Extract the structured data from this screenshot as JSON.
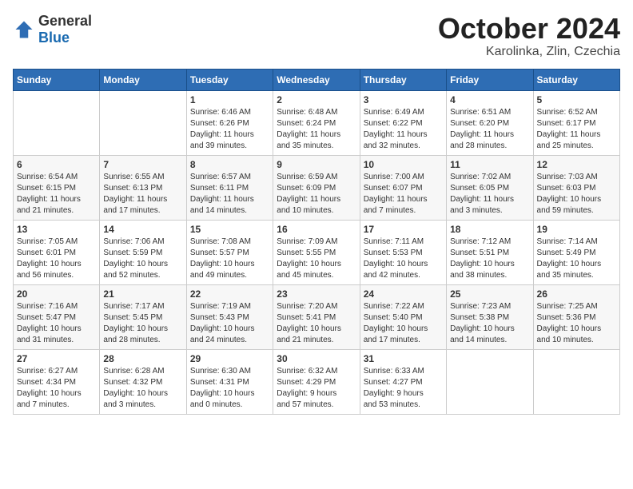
{
  "header": {
    "logo": {
      "general": "General",
      "blue": "Blue"
    },
    "month": "October 2024",
    "location": "Karolinka, Zlin, Czechia"
  },
  "weekdays": [
    "Sunday",
    "Monday",
    "Tuesday",
    "Wednesday",
    "Thursday",
    "Friday",
    "Saturday"
  ],
  "weeks": [
    [
      {
        "day": "",
        "info": ""
      },
      {
        "day": "",
        "info": ""
      },
      {
        "day": "1",
        "info": "Sunrise: 6:46 AM\nSunset: 6:26 PM\nDaylight: 11 hours\nand 39 minutes."
      },
      {
        "day": "2",
        "info": "Sunrise: 6:48 AM\nSunset: 6:24 PM\nDaylight: 11 hours\nand 35 minutes."
      },
      {
        "day": "3",
        "info": "Sunrise: 6:49 AM\nSunset: 6:22 PM\nDaylight: 11 hours\nand 32 minutes."
      },
      {
        "day": "4",
        "info": "Sunrise: 6:51 AM\nSunset: 6:20 PM\nDaylight: 11 hours\nand 28 minutes."
      },
      {
        "day": "5",
        "info": "Sunrise: 6:52 AM\nSunset: 6:17 PM\nDaylight: 11 hours\nand 25 minutes."
      }
    ],
    [
      {
        "day": "6",
        "info": "Sunrise: 6:54 AM\nSunset: 6:15 PM\nDaylight: 11 hours\nand 21 minutes."
      },
      {
        "day": "7",
        "info": "Sunrise: 6:55 AM\nSunset: 6:13 PM\nDaylight: 11 hours\nand 17 minutes."
      },
      {
        "day": "8",
        "info": "Sunrise: 6:57 AM\nSunset: 6:11 PM\nDaylight: 11 hours\nand 14 minutes."
      },
      {
        "day": "9",
        "info": "Sunrise: 6:59 AM\nSunset: 6:09 PM\nDaylight: 11 hours\nand 10 minutes."
      },
      {
        "day": "10",
        "info": "Sunrise: 7:00 AM\nSunset: 6:07 PM\nDaylight: 11 hours\nand 7 minutes."
      },
      {
        "day": "11",
        "info": "Sunrise: 7:02 AM\nSunset: 6:05 PM\nDaylight: 11 hours\nand 3 minutes."
      },
      {
        "day": "12",
        "info": "Sunrise: 7:03 AM\nSunset: 6:03 PM\nDaylight: 10 hours\nand 59 minutes."
      }
    ],
    [
      {
        "day": "13",
        "info": "Sunrise: 7:05 AM\nSunset: 6:01 PM\nDaylight: 10 hours\nand 56 minutes."
      },
      {
        "day": "14",
        "info": "Sunrise: 7:06 AM\nSunset: 5:59 PM\nDaylight: 10 hours\nand 52 minutes."
      },
      {
        "day": "15",
        "info": "Sunrise: 7:08 AM\nSunset: 5:57 PM\nDaylight: 10 hours\nand 49 minutes."
      },
      {
        "day": "16",
        "info": "Sunrise: 7:09 AM\nSunset: 5:55 PM\nDaylight: 10 hours\nand 45 minutes."
      },
      {
        "day": "17",
        "info": "Sunrise: 7:11 AM\nSunset: 5:53 PM\nDaylight: 10 hours\nand 42 minutes."
      },
      {
        "day": "18",
        "info": "Sunrise: 7:12 AM\nSunset: 5:51 PM\nDaylight: 10 hours\nand 38 minutes."
      },
      {
        "day": "19",
        "info": "Sunrise: 7:14 AM\nSunset: 5:49 PM\nDaylight: 10 hours\nand 35 minutes."
      }
    ],
    [
      {
        "day": "20",
        "info": "Sunrise: 7:16 AM\nSunset: 5:47 PM\nDaylight: 10 hours\nand 31 minutes."
      },
      {
        "day": "21",
        "info": "Sunrise: 7:17 AM\nSunset: 5:45 PM\nDaylight: 10 hours\nand 28 minutes."
      },
      {
        "day": "22",
        "info": "Sunrise: 7:19 AM\nSunset: 5:43 PM\nDaylight: 10 hours\nand 24 minutes."
      },
      {
        "day": "23",
        "info": "Sunrise: 7:20 AM\nSunset: 5:41 PM\nDaylight: 10 hours\nand 21 minutes."
      },
      {
        "day": "24",
        "info": "Sunrise: 7:22 AM\nSunset: 5:40 PM\nDaylight: 10 hours\nand 17 minutes."
      },
      {
        "day": "25",
        "info": "Sunrise: 7:23 AM\nSunset: 5:38 PM\nDaylight: 10 hours\nand 14 minutes."
      },
      {
        "day": "26",
        "info": "Sunrise: 7:25 AM\nSunset: 5:36 PM\nDaylight: 10 hours\nand 10 minutes."
      }
    ],
    [
      {
        "day": "27",
        "info": "Sunrise: 6:27 AM\nSunset: 4:34 PM\nDaylight: 10 hours\nand 7 minutes."
      },
      {
        "day": "28",
        "info": "Sunrise: 6:28 AM\nSunset: 4:32 PM\nDaylight: 10 hours\nand 3 minutes."
      },
      {
        "day": "29",
        "info": "Sunrise: 6:30 AM\nSunset: 4:31 PM\nDaylight: 10 hours\nand 0 minutes."
      },
      {
        "day": "30",
        "info": "Sunrise: 6:32 AM\nSunset: 4:29 PM\nDaylight: 9 hours\nand 57 minutes."
      },
      {
        "day": "31",
        "info": "Sunrise: 6:33 AM\nSunset: 4:27 PM\nDaylight: 9 hours\nand 53 minutes."
      },
      {
        "day": "",
        "info": ""
      },
      {
        "day": "",
        "info": ""
      }
    ]
  ]
}
